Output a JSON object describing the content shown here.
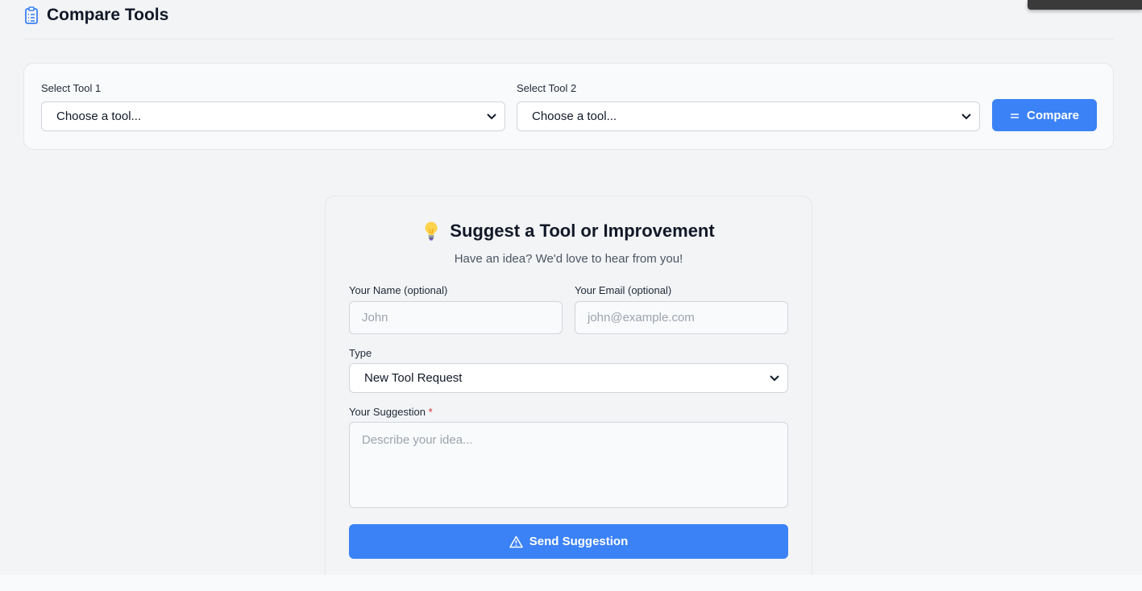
{
  "header": {
    "title": "Compare Tools",
    "icon": "clipboard-list-icon"
  },
  "compare": {
    "tool1_label": "Select Tool 1",
    "tool1_value": "Choose a tool...",
    "tool2_label": "Select Tool 2",
    "tool2_value": "Choose a tool...",
    "button_label": "Compare",
    "button_icon": "equals-icon"
  },
  "suggest": {
    "icon": "lightbulb-icon",
    "title": "Suggest a Tool or Improvement",
    "subtitle": "Have an idea? We'd love to hear from you!",
    "name_label": "Your Name (optional)",
    "name_placeholder": "John",
    "email_label": "Your Email (optional)",
    "email_placeholder": "john@example.com",
    "type_label": "Type",
    "type_value": "New Tool Request",
    "suggestion_label": "Your Suggestion",
    "required_mark": "*",
    "suggestion_placeholder": "Describe your idea...",
    "send_label": "Send Suggestion",
    "send_icon": "warning-triangle-icon"
  },
  "colors": {
    "accent": "#3b82f6",
    "background": "#f3f4f6",
    "required": "#dc2626"
  }
}
